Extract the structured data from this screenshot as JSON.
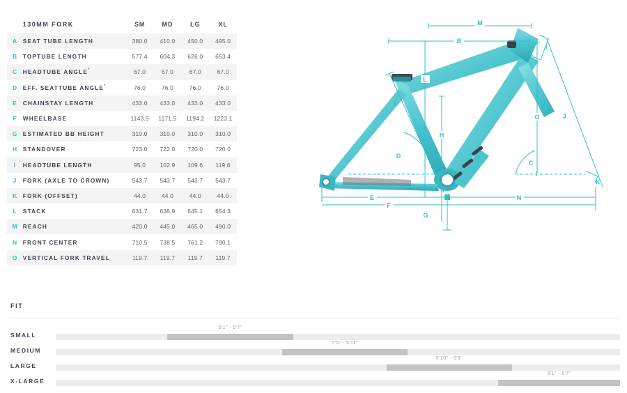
{
  "table": {
    "title": "130MM FORK",
    "sizes": [
      "SM",
      "MD",
      "LG",
      "XL"
    ],
    "rows": [
      {
        "letter": "A",
        "label": "SEAT TUBE LENGTH",
        "deg": false,
        "values": [
          "380.0",
          "410.0",
          "450.0",
          "495.0"
        ]
      },
      {
        "letter": "B",
        "label": "TOPTUBE LENGTH",
        "deg": false,
        "values": [
          "577.4",
          "604.3",
          "626.0",
          "653.4"
        ]
      },
      {
        "letter": "C",
        "label": "HEADTUBE ANGLE",
        "deg": true,
        "values": [
          "67.0",
          "67.0",
          "67.0",
          "67.0"
        ]
      },
      {
        "letter": "D",
        "label": "EFF. SEATTUBE ANGLE",
        "deg": true,
        "values": [
          "76.0",
          "76.0",
          "76.0",
          "76.0"
        ]
      },
      {
        "letter": "E",
        "label": "CHAINSTAY LENGTH",
        "deg": false,
        "values": [
          "433.0",
          "433.0",
          "433.0",
          "433.0"
        ]
      },
      {
        "letter": "F",
        "label": "WHEELBASE",
        "deg": false,
        "values": [
          "1143.5",
          "1171.5",
          "1194.2",
          "1223.1"
        ]
      },
      {
        "letter": "G",
        "label": "ESTIMATED BB HEIGHT",
        "deg": false,
        "values": [
          "310.0",
          "310.0",
          "310.0",
          "310.0"
        ]
      },
      {
        "letter": "H",
        "label": "STANDOVER",
        "deg": false,
        "values": [
          "723.0",
          "722.0",
          "720.0",
          "720.0"
        ]
      },
      {
        "letter": "I",
        "label": "HEADTUBE LENGTH",
        "deg": false,
        "values": [
          "95.0",
          "102.9",
          "109.6",
          "119.6"
        ]
      },
      {
        "letter": "J",
        "label": "FORK (AXLE TO CROWN)",
        "deg": false,
        "values": [
          "543.7",
          "543.7",
          "543.7",
          "543.7"
        ]
      },
      {
        "letter": "K",
        "label": "FORK (OFFSET)",
        "deg": false,
        "values": [
          "44.0",
          "44.0",
          "44.0",
          "44.0"
        ]
      },
      {
        "letter": "L",
        "label": "STACK",
        "deg": false,
        "values": [
          "631.7",
          "638.9",
          "645.1",
          "654.3"
        ]
      },
      {
        "letter": "M",
        "label": "REACH",
        "deg": false,
        "values": [
          "420.0",
          "445.0",
          "465.0",
          "490.0"
        ]
      },
      {
        "letter": "N",
        "label": "FRONT CENTER",
        "deg": false,
        "values": [
          "710.5",
          "738.5",
          "761.2",
          "790.1"
        ]
      },
      {
        "letter": "O",
        "label": "VERTICAL FORK TRAVEL",
        "deg": false,
        "values": [
          "119.7",
          "119.7",
          "119.7",
          "119.7"
        ]
      }
    ]
  },
  "diagram": {
    "callouts": [
      "M",
      "B",
      "L",
      "H",
      "A",
      "I",
      "O",
      "J",
      "C",
      "D",
      "E",
      "F",
      "G",
      "N",
      "K"
    ],
    "frame_color": "#4fc6cf",
    "line_color": "#2dbfce"
  },
  "fit": {
    "title": "FIT",
    "rows": [
      {
        "label": "SMALL",
        "range": "5'1\" - 5'7\"",
        "start_pct": 19.8,
        "width_pct": 22.3
      },
      {
        "label": "MEDIUM",
        "range": "5'5\" - 5'11\"",
        "start_pct": 40.1,
        "width_pct": 22.3
      },
      {
        "label": "LARGE",
        "range": "5'10\" - 6'3\"",
        "start_pct": 58.6,
        "width_pct": 22.3
      },
      {
        "label": "X-LARGE",
        "range": "6'1\" - 6'7\"",
        "start_pct": 78.4,
        "width_pct": 21.6
      }
    ]
  }
}
